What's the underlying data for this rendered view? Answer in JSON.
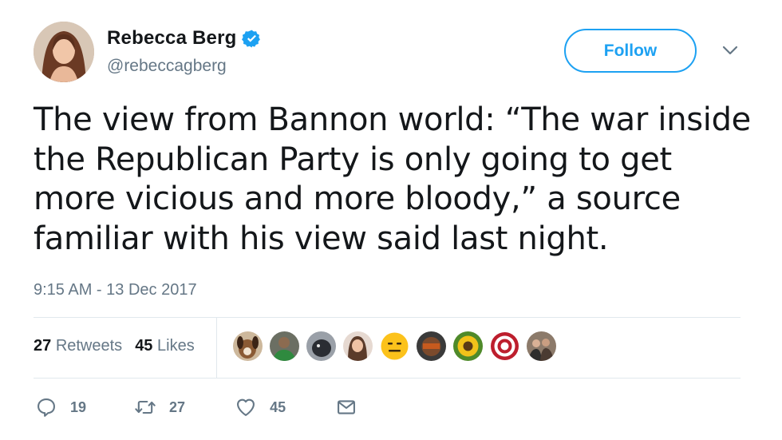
{
  "author": {
    "name": "Rebecca Berg",
    "handle": "@rebeccagberg",
    "verified": true
  },
  "follow_label": "Follow",
  "tweet": {
    "text_lines": [
      "The view from Bannon world: “The war inside",
      "the Republican Party is only going to get",
      "more vicious and more bloody,” a source",
      "familiar with his view said last night."
    ],
    "timestamp": "9:15 AM - 13 Dec 2017"
  },
  "stats": {
    "retweets": "27",
    "retweets_label": "Retweets",
    "likes": "45",
    "likes_label": "Likes"
  },
  "likers": [
    {
      "icon": "avatar-dog"
    },
    {
      "icon": "avatar-person-green"
    },
    {
      "icon": "avatar-animal-dark"
    },
    {
      "icon": "avatar-woman"
    },
    {
      "icon": "avatar-expressionless-emoji"
    },
    {
      "icon": "avatar-bears-logo"
    },
    {
      "icon": "avatar-sunflower"
    },
    {
      "icon": "avatar-red-sox-logo"
    },
    {
      "icon": "avatar-group-photo"
    }
  ],
  "actions": {
    "replies": "19",
    "retweets": "27",
    "likes": "45"
  },
  "colors": {
    "accent": "#1da1f2",
    "muted": "#657786",
    "text": "#14171a",
    "divider": "#e1e8ed"
  }
}
